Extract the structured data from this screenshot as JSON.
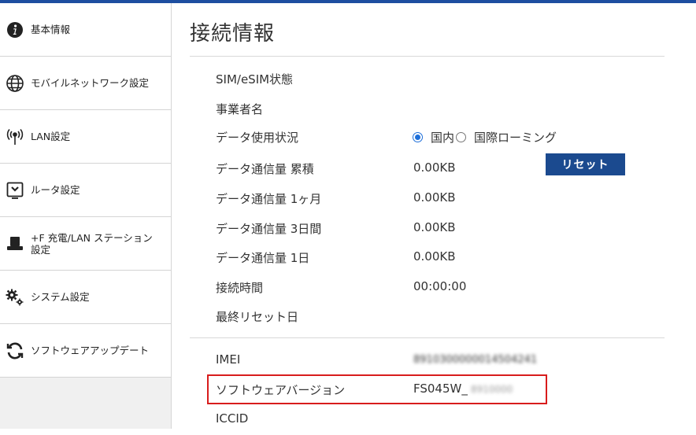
{
  "sidebar": {
    "items": [
      {
        "label": "基本情報",
        "icon": "info-icon"
      },
      {
        "label": "モバイルネットワーク設定",
        "icon": "globe-icon"
      },
      {
        "label": "LAN設定",
        "icon": "antenna-icon"
      },
      {
        "label": "ルータ設定",
        "icon": "router-icon"
      },
      {
        "label": "+F 充電/LAN ステーション",
        "label2": "設定",
        "icon": "cradle-icon"
      },
      {
        "label": "システム設定",
        "icon": "gears-icon"
      },
      {
        "label": "ソフトウェアアップデート",
        "icon": "refresh-icon"
      }
    ]
  },
  "main": {
    "title": "接続情報",
    "rows": {
      "sim": {
        "key": "SIM/eSIM状態",
        "value": ""
      },
      "carrier": {
        "key": "事業者名",
        "value": ""
      },
      "usage": {
        "key": "データ使用状況",
        "opt_domestic": "国内",
        "opt_roaming": "国際ローミング",
        "selected": "国内"
      },
      "total": {
        "key": "データ通信量 累積",
        "value": "0.00KB"
      },
      "month": {
        "key": "データ通信量 1ヶ月",
        "value": "0.00KB"
      },
      "three_days": {
        "key": "データ通信量 3日間",
        "value": "0.00KB"
      },
      "day": {
        "key": "データ通信量 1日",
        "value": "0.00KB"
      },
      "conn_time": {
        "key": "接続時間",
        "value": "00:00:00"
      },
      "last_reset": {
        "key": "最終リセット日",
        "value": ""
      },
      "imei": {
        "key": "IMEI",
        "value": "8910300000014504241"
      },
      "sw_version": {
        "key": "ソフトウェアバージョン",
        "value_prefix": "FS045W_",
        "value_suffix": "8910000"
      },
      "iccid": {
        "key": "ICCID",
        "value": ""
      }
    },
    "reset_label": "リセット"
  },
  "colors": {
    "accent": "#1b4a8f",
    "top_bar": "#1d4ea0",
    "radio": "#1e6fd9",
    "highlight": "#d81c1c"
  }
}
